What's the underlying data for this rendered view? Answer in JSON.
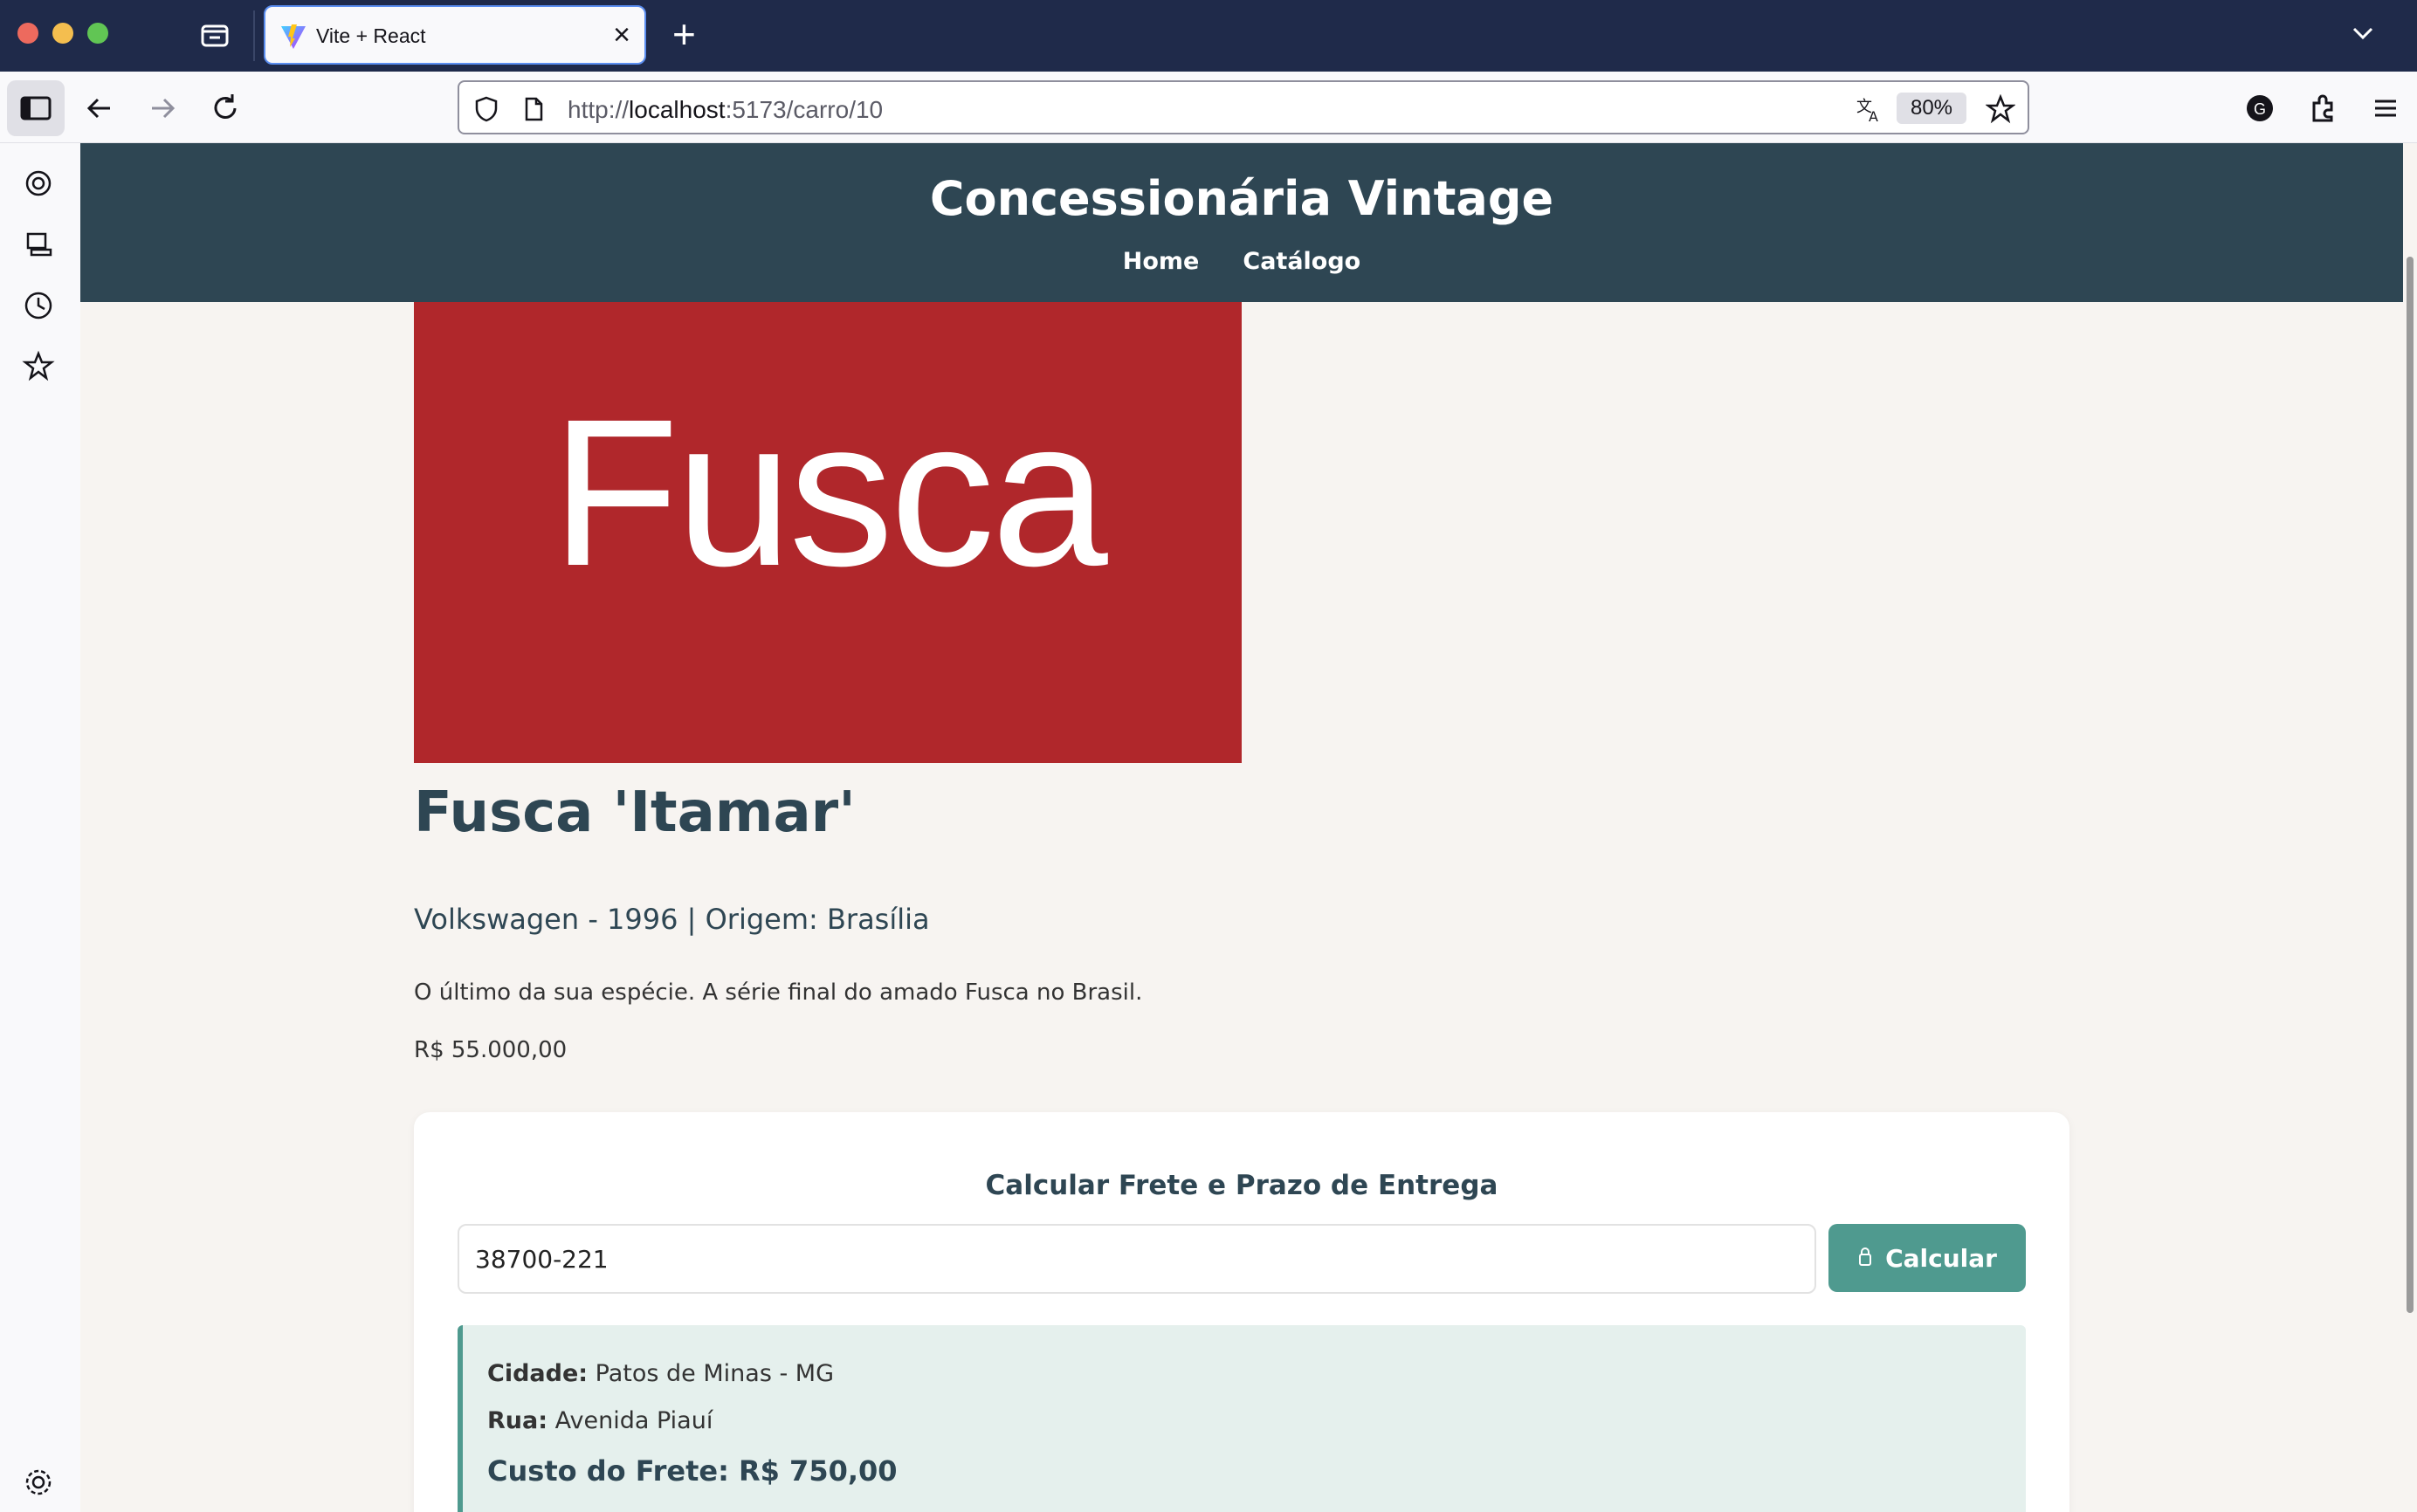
{
  "browser": {
    "tab_title": "Vite + React",
    "url_scheme": "http://",
    "url_host": "localhost",
    "url_rest": ":5173/carro/10",
    "zoom": "80%",
    "colors": {
      "chrome_dark": "#1f2a4a",
      "toolbar": "#f9f9fb"
    }
  },
  "site": {
    "title": "Concessionária Vintage",
    "nav": [
      "Home",
      "Catálogo"
    ],
    "colors": {
      "header": "#2e4653",
      "accent": "#4f9a8f",
      "image_bg": "#b0272b"
    }
  },
  "car": {
    "image_text": "Fusca",
    "name": "Fusca 'Itamar'",
    "meta": "Volkswagen - 1996 | Origem: Brasília",
    "description": "O último da sua espécie. A série final do amado Fusca no Brasil.",
    "price": "R$ 55.000,00"
  },
  "frete": {
    "title": "Calcular Frete e Prazo de Entrega",
    "cep_value": "38700-221",
    "button_label": "Calcular",
    "result": {
      "city_label": "Cidade:",
      "city_value": "Patos de Minas - MG",
      "street_label": "Rua:",
      "street_value": "Avenida Piauí",
      "cost_label": "Custo do Frete:",
      "cost_value": "R$ 750,00"
    }
  }
}
